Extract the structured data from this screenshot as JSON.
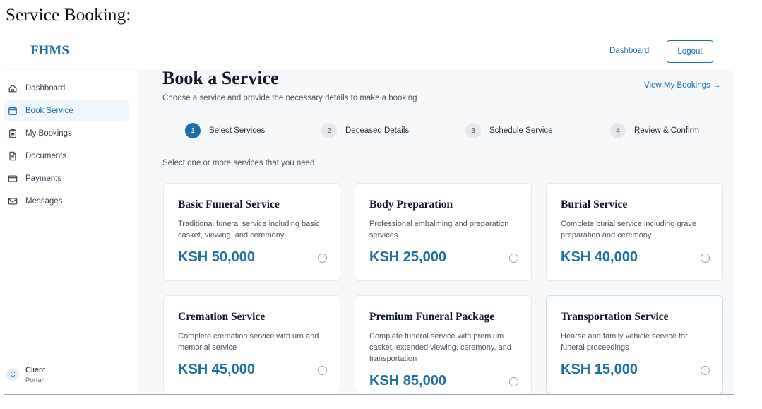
{
  "document": {
    "heading": "Service Booking:"
  },
  "topbar": {
    "brand": "FHMS",
    "dashboard_link": "Dashboard",
    "logout_label": "Logout"
  },
  "sidebar": {
    "items": [
      {
        "label": "Dashboard",
        "icon": "home-icon",
        "active": false
      },
      {
        "label": "Book Service",
        "icon": "calendar-icon",
        "active": true
      },
      {
        "label": "My Bookings",
        "icon": "clipboard-icon",
        "active": false
      },
      {
        "label": "Documents",
        "icon": "file-icon",
        "active": false
      },
      {
        "label": "Payments",
        "icon": "credit-card-icon",
        "active": false
      },
      {
        "label": "Messages",
        "icon": "mail-icon",
        "active": false
      }
    ],
    "user": {
      "initial": "C",
      "name": "Client",
      "role": "Portal"
    }
  },
  "main": {
    "title": "Book a Service",
    "subtitle": "Choose a service and provide the necessary details to make a booking",
    "view_bookings": "View My Bookings →",
    "steps": [
      {
        "number": "1",
        "label": "Select Services",
        "active": true
      },
      {
        "number": "2",
        "label": "Deceased Details",
        "active": false
      },
      {
        "number": "3",
        "label": "Schedule Service",
        "active": false
      },
      {
        "number": "4",
        "label": "Review & Confirm",
        "active": false
      }
    ],
    "hint": "Select one or more services that you need",
    "services": [
      {
        "title": "Basic Funeral Service",
        "description": "Traditional funeral service including basic casket, viewing, and ceremony",
        "price": "KSH 50,000",
        "selected": false
      },
      {
        "title": "Body Preparation",
        "description": "Professional embalming and preparation services",
        "price": "KSH 25,000",
        "selected": false
      },
      {
        "title": "Burial Service",
        "description": "Complete burial service including grave preparation and ceremony",
        "price": "KSH 40,000",
        "selected": false
      },
      {
        "title": "Cremation Service",
        "description": "Complete cremation service with urn and memorial service",
        "price": "KSH 45,000",
        "selected": false
      },
      {
        "title": "Premium Funeral Package",
        "description": "Complete funeral service with premium casket, extended viewing, ceremony, and transportation",
        "price": "KSH 85,000",
        "selected": false
      },
      {
        "title": "Transportation Service",
        "description": "Hearse and family vehicle service for funeral proceedings",
        "price": "KSH 15,000",
        "selected": false
      }
    ]
  },
  "colors": {
    "accent": "#1e6fa8",
    "active_bg": "#eef5fb",
    "main_bg": "#f7f8fa"
  }
}
